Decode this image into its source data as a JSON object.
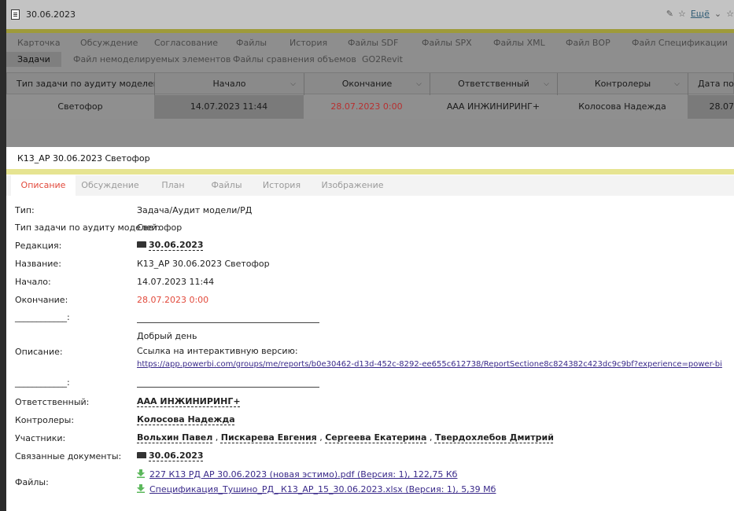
{
  "window": {
    "title": "30.06.2023",
    "more_label": "Ещё",
    "pencil_glyph": "✎",
    "star_glyph": "☆",
    "chevron_glyph": "⌄"
  },
  "bg_tabs_row1": [
    "Карточка",
    "Обсуждение",
    "Согласование",
    "Файлы",
    "История",
    "Файлы SDF",
    "Файлы SPX",
    "Файлы XML",
    "Файл ВОР",
    "Файл Спецификации"
  ],
  "bg_tabs_row2": [
    "Задачи",
    "Файл немоделируемых элементов",
    "Файлы сравнения объемов",
    "GO2Revit"
  ],
  "bg_table": {
    "headers": [
      "Тип задачи по аудиту моделей",
      "Начало",
      "Окончание",
      "Ответственный",
      "Контролеры",
      "Дата послед"
    ],
    "row": [
      "Светофор",
      "14.07.2023 11:44",
      "28.07.2023 0:00",
      "ААА ИНЖИНИРИНГ+",
      "Колосова Надежда",
      "28.07"
    ]
  },
  "dialog": {
    "title": "К13_АР 30.06.2023 Светофор",
    "tabs": [
      "Описание",
      "Обсуждение",
      "План",
      "Файлы",
      "История",
      "Изображение"
    ],
    "fields": {
      "type_label": "Тип:",
      "type_value": "Задача/Аудит модели/РД",
      "audit_type_label": "Тип задачи по аудиту моделей:",
      "audit_type_value": "Светофор",
      "edition_label": "Редакция:",
      "edition_value": "30.06.2023",
      "name_label": "Название:",
      "name_value": "К13_АР 30.06.2023 Светофор",
      "start_label": "Начало:",
      "start_value": "14.07.2023 11:44",
      "end_label": "Окончание:",
      "end_value": "28.07.2023 0:00",
      "sep_label": "____________:",
      "description_label": "Описание:",
      "description_line1": "Добрый день",
      "description_line2": "Ссылка на интерактивную версию:",
      "description_link": "https://app.powerbi.com/groups/me/reports/b0e30462-d13d-452c-8292-ee655c612738/ReportSectione8c824382c423dc9c9bf?experience=power-bi",
      "sep_label2": "____________:",
      "responsible_label": "Ответственный:",
      "responsible_value": "ААА ИНЖИНИРИНГ+",
      "controllers_label": "Контролеры:",
      "controllers_value": "Колосова Надежда",
      "participants_label": "Участники:",
      "participants": [
        "Вольхин Павел",
        "Пискарева Евгения",
        "Сергеева Екатерина",
        "Твердохлебов Дмитрий"
      ],
      "related_label": "Связанные документы:",
      "related_value": "30.06.2023",
      "files_label": "Файлы:",
      "files": [
        "227 К13 РД АР 30.06.2023 (новая эстимо).pdf (Версия: 1), 122,75 Кб",
        "Спецификация_Тушино_РД_ К13_АР_15_30.06.2023.xlsx (Версия: 1), 5,39 Мб"
      ]
    }
  },
  "colors": {
    "accent_red": "#e24a3c",
    "link": "#3a2a8a",
    "yellow_bar": "#e6e491",
    "download_green": "#5cb85c"
  }
}
